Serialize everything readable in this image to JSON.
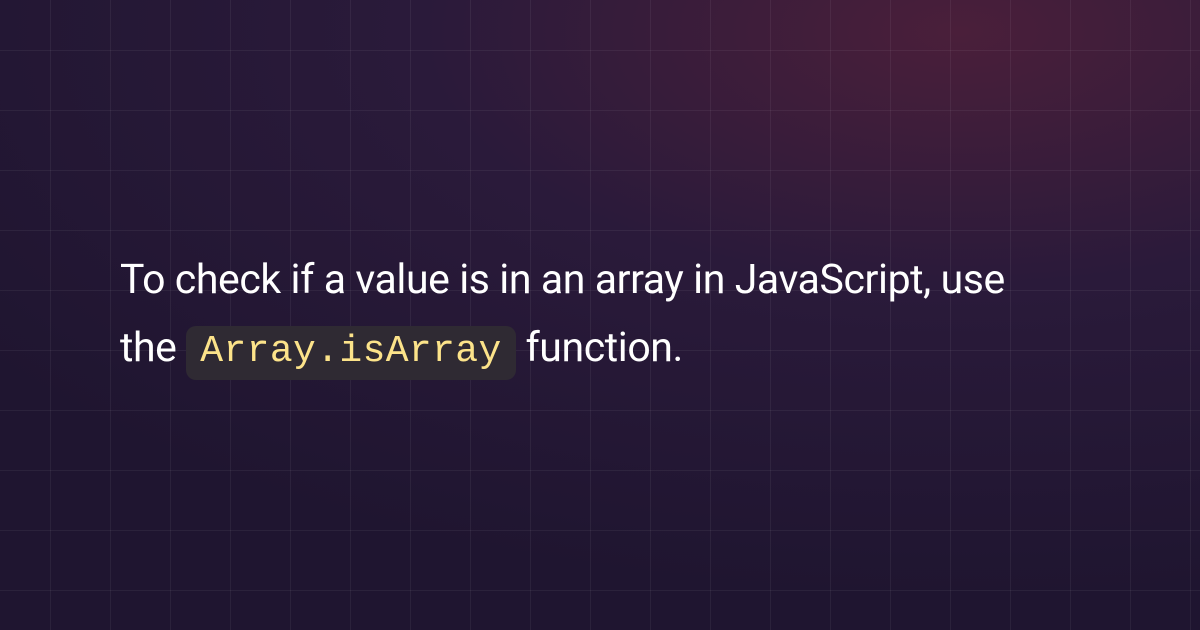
{
  "summary": {
    "text_before": "To check if a value is in an array in JavaScript, use the ",
    "code": "Array.isArray",
    "text_after": " function."
  }
}
